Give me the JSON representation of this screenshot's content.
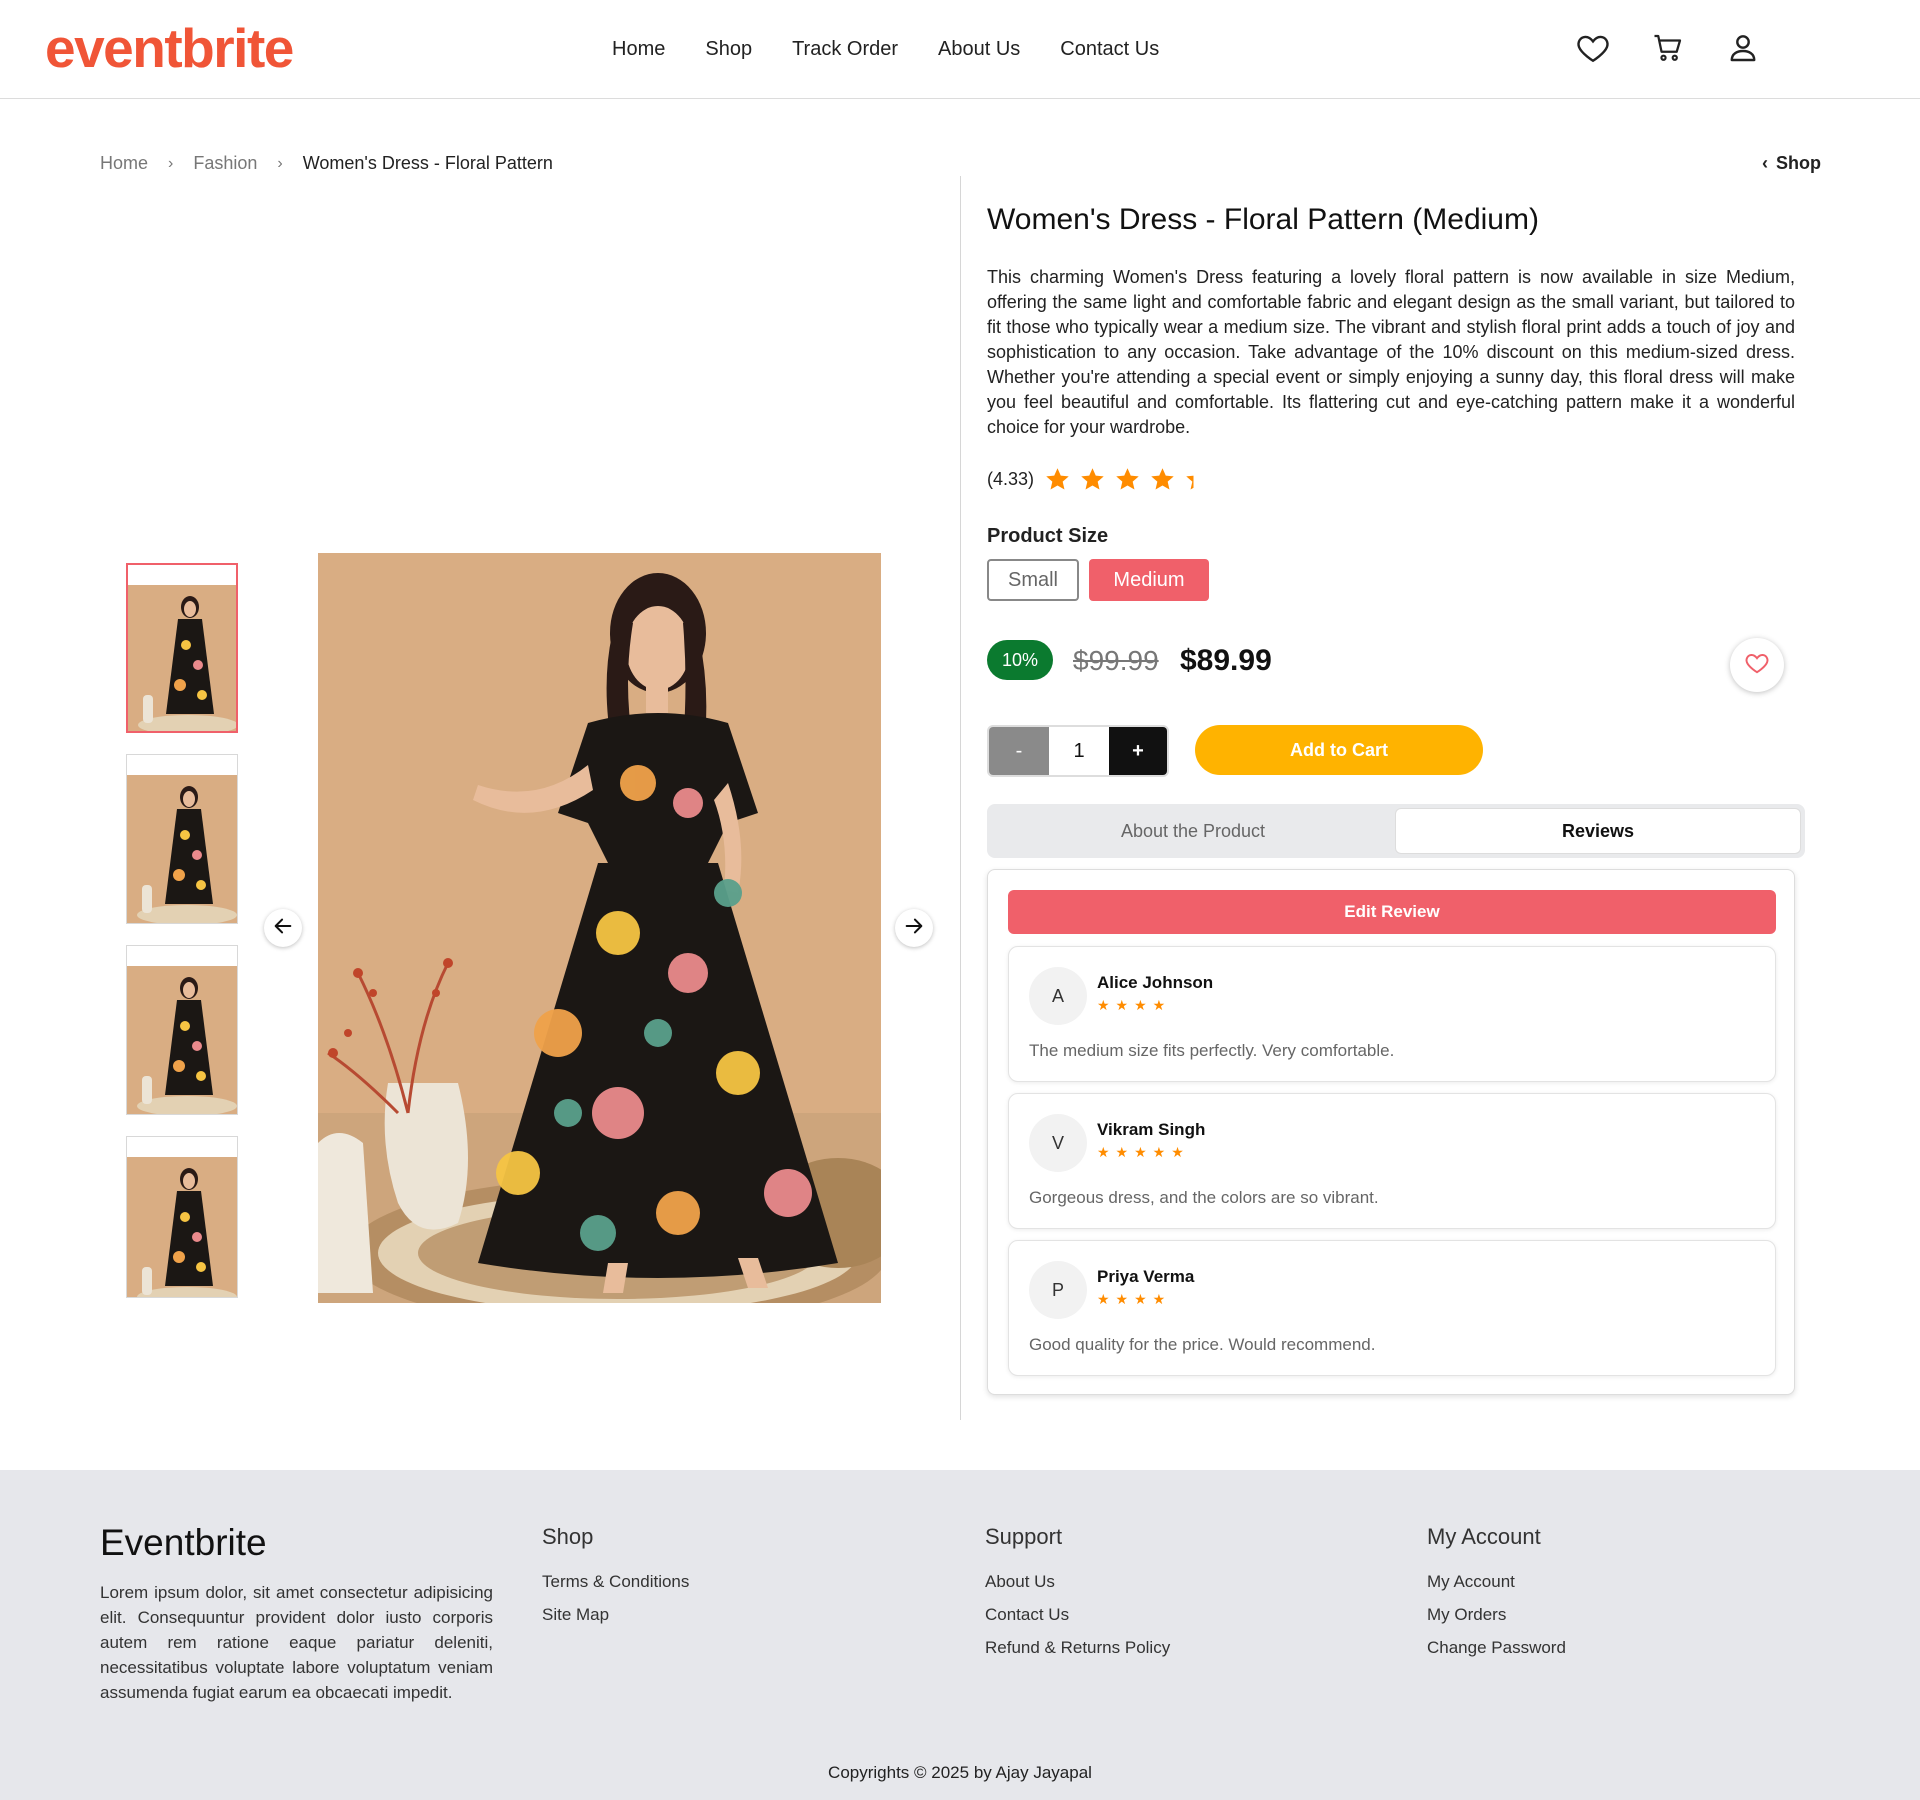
{
  "header": {
    "logo": "eventbrite",
    "nav": [
      "Home",
      "Shop",
      "Track Order",
      "About Us",
      "Contact Us"
    ],
    "icons": [
      "heart-icon",
      "cart-icon",
      "user-icon"
    ]
  },
  "breadcrumb": {
    "items": [
      "Home",
      "Fashion",
      "Women's Dress - Floral Pattern"
    ],
    "back_label": "Shop"
  },
  "product": {
    "title": "Women's Dress - Floral Pattern (Medium)",
    "description": "This charming Women's Dress featuring a lovely floral pattern is now available in size Medium, offering the same light and comfortable fabric and elegant design as the small variant, but tailored to fit those who typically wear a medium size. The vibrant and stylish floral print adds a touch of joy and sophistication to any occasion. Take advantage of the 10% discount on this medium-sized dress. Whether you're attending a special event or simply enjoying a sunny day, this floral dress will make you feel beautiful and comfortable. Its flattering cut and eye-catching pattern make it a wonderful choice for your wardrobe.",
    "rating_text": "(4.33)",
    "rating_value": 4.33,
    "size_label": "Product Size",
    "sizes": [
      "Small",
      "Medium"
    ],
    "selected_size": "Medium",
    "discount": "10%",
    "old_price": "$99.99",
    "new_price": "$89.99",
    "quantity": "1",
    "qty_minus": "-",
    "qty_plus": "+",
    "add_to_cart": "Add to Cart",
    "thumbnail_count": 4
  },
  "tabs": [
    "About the Product",
    "Reviews"
  ],
  "active_tab": "Reviews",
  "reviews": {
    "edit_label": "Edit Review",
    "items": [
      {
        "initial": "A",
        "name": "Alice Johnson",
        "stars": "★★★★",
        "rating": 4,
        "text": "The medium size fits perfectly. Very comfortable."
      },
      {
        "initial": "V",
        "name": "Vikram Singh",
        "stars": "★★★★★",
        "rating": 5,
        "text": "Gorgeous dress, and the colors are so vibrant."
      },
      {
        "initial": "P",
        "name": "Priya Verma",
        "stars": "★★★★",
        "rating": 4,
        "text": "Good quality for the price. Would recommend."
      }
    ]
  },
  "footer": {
    "brand": "Eventbrite",
    "about": "Lorem ipsum dolor, sit amet consectetur adipisicing elit. Consequuntur provident dolor iusto corporis autem rem ratione eaque pariatur deleniti, necessitatibus voluptate labore voluptatum veniam assumenda fugiat earum ea obcaecati impedit.",
    "shop": {
      "title": "Shop",
      "links": [
        "Terms & Conditions",
        "Site Map"
      ]
    },
    "support": {
      "title": "Support",
      "links": [
        "About Us",
        "Contact Us",
        "Refund & Returns Policy"
      ]
    },
    "account": {
      "title": "My Account",
      "links": [
        "My Account",
        "My Orders",
        "Change Password"
      ]
    },
    "copyright": "Copyrights © 2025 by Ajay Jayapal"
  },
  "colors": {
    "brand": "#f05537",
    "accent": "#f0606a",
    "discount": "#0b7a2f",
    "cta": "#ffb300",
    "star": "#ff8c00"
  }
}
